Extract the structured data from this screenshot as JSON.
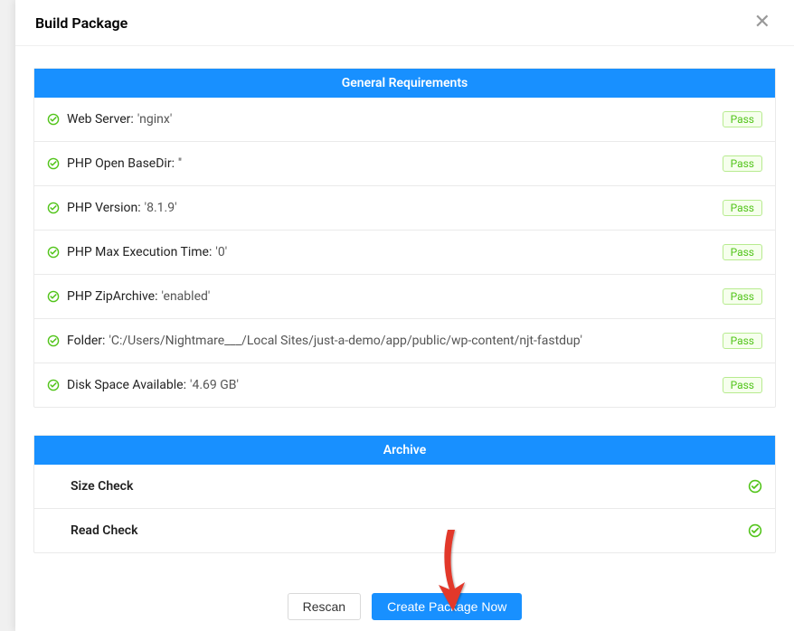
{
  "modal": {
    "title": "Build Package"
  },
  "sections": {
    "general": {
      "header": "General Requirements",
      "items": [
        {
          "label": "Web Server:",
          "value": " 'nginx'",
          "status": "Pass"
        },
        {
          "label": "PHP Open BaseDir:",
          "value": " ''",
          "status": "Pass"
        },
        {
          "label": "PHP Version:",
          "value": " '8.1.9'",
          "status": "Pass"
        },
        {
          "label": "PHP Max Execution Time:",
          "value": " '0'",
          "status": "Pass"
        },
        {
          "label": "PHP ZipArchive:",
          "value": " 'enabled'",
          "status": "Pass"
        },
        {
          "label": "Folder:",
          "value": " 'C:/Users/Nightmare___/Local Sites/just-a-demo/app/public/wp-content/njt-fastdup'",
          "status": "Pass"
        },
        {
          "label": "Disk Space Available:",
          "value": " '4.69 GB'",
          "status": "Pass"
        }
      ]
    },
    "archive": {
      "header": "Archive",
      "items": [
        {
          "label": "Size Check"
        },
        {
          "label": "Read Check"
        }
      ]
    }
  },
  "footer": {
    "rescan": "Rescan",
    "create": "Create Package Now"
  }
}
